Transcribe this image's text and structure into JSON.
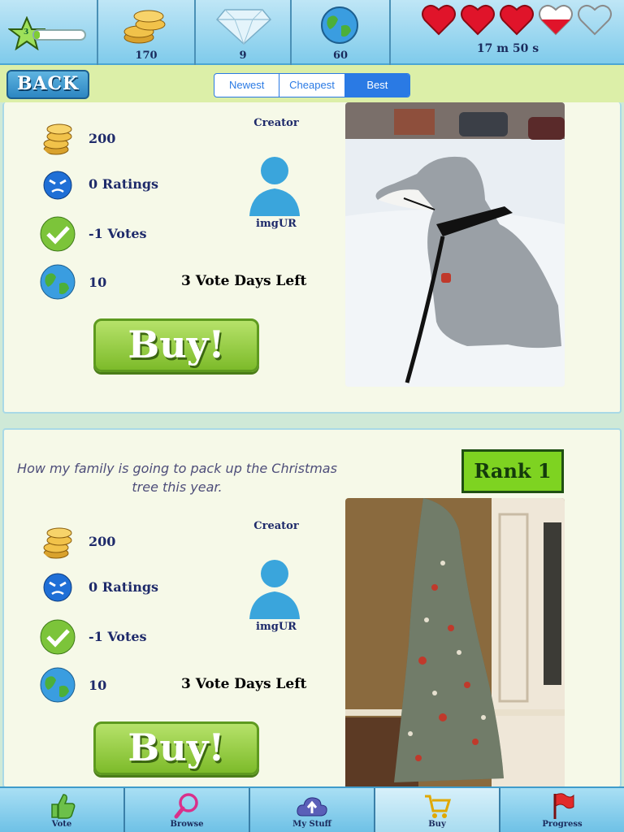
{
  "hud": {
    "level": "3",
    "xp_fraction": 0.12,
    "coins": "170",
    "gems": "9",
    "globes": "60",
    "hearts": {
      "full": 3,
      "partial": 1,
      "empty": 1,
      "partial_fill": 0.5
    },
    "timer": "17 m 50 s"
  },
  "nav": {
    "back_label": "BACK",
    "sort_tabs": [
      {
        "label": "Newest",
        "active": false
      },
      {
        "label": "Cheapest",
        "active": false
      },
      {
        "label": "Best",
        "active": true
      }
    ]
  },
  "cards": [
    {
      "caption": "",
      "price": "200",
      "ratings": "0 Ratings",
      "votes": "-1 Votes",
      "globes": "10",
      "days_left": "3 Vote Days Left",
      "creator_label": "Creator",
      "creator_name": "imgUR",
      "buy_label": "Buy!",
      "rank": "",
      "photo": "dog-in-hoodie-snow"
    },
    {
      "caption": "How my family is going to pack up the Christmas tree this year.",
      "price": "200",
      "ratings": "0 Ratings",
      "votes": "-1 Votes",
      "globes": "10",
      "days_left": "3 Vote Days Left",
      "creator_label": "Creator",
      "creator_name": "imgUR",
      "buy_label": "Buy!",
      "rank": "Rank 1",
      "photo": "wrapped-christmas-tree"
    }
  ],
  "tabs": [
    {
      "label": "Vote",
      "icon": "thumbs-up-icon",
      "active": false
    },
    {
      "label": "Browse",
      "icon": "magnifier-icon",
      "active": false
    },
    {
      "label": "My Stuff",
      "icon": "cloud-upload-icon",
      "active": false
    },
    {
      "label": "Buy",
      "icon": "cart-icon",
      "active": true
    },
    {
      "label": "Progress",
      "icon": "flag-icon",
      "active": false
    }
  ],
  "colors": {
    "sky": "#7fcbeb",
    "accent_green": "#7ed321",
    "buy_green": "#8cc63f",
    "seg_blue": "#2a7ae4",
    "heart_red": "#e0142a",
    "text_navy": "#1e2a6a"
  }
}
